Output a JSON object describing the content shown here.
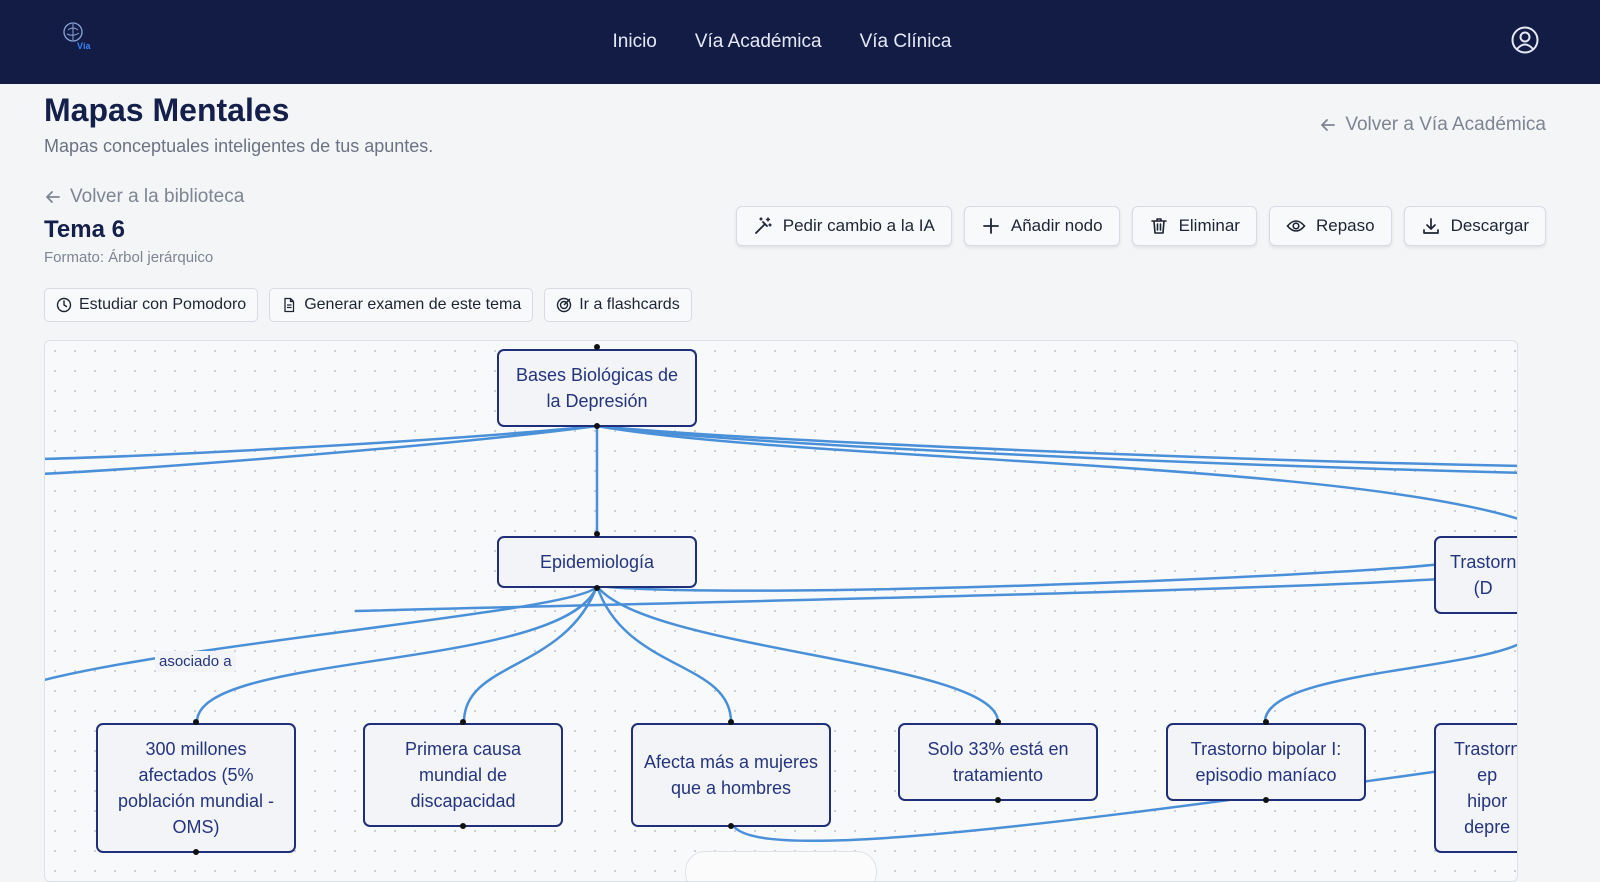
{
  "brand": {
    "logo_text": "Vía"
  },
  "nav": {
    "items": [
      "Inicio",
      "Vía Académica",
      "Vía Clínica"
    ]
  },
  "header": {
    "title": "Mapas Mentales",
    "subtitle": "Mapas conceptuales inteligentes de tus apuntes.",
    "back_academic": "Volver a Vía Académica"
  },
  "topic": {
    "back_library": "Volver a la biblioteca",
    "title": "Tema 6",
    "format": "Formato: Árbol jerárquico"
  },
  "toolbar": {
    "ai_change": "Pedir cambio a la IA",
    "add_node": "Añadir nodo",
    "delete": "Eliminar",
    "review": "Repaso",
    "download": "Descargar"
  },
  "actions": {
    "pomodoro": "Estudiar con Pomodoro",
    "exam": "Generar examen de este tema",
    "flashcards": "Ir a flashcards"
  },
  "mindmap": {
    "root": "Bases Biológicas de la Depresión",
    "epidemiology": "Epidemiología",
    "right_top_partial": "Trastorn\n(D",
    "leaves": [
      "300 millones afectados (5% población mundial - OMS)",
      "Primera causa mundial de discapacidad",
      "Afecta más a mujeres que a hombres",
      "Solo 33% está en tratamiento",
      "Trastorno bipolar I: episodio maníaco"
    ],
    "right_bottom_partial": "Trastorn\nep\nhipor\ndepre",
    "edge_label": "asociado a"
  },
  "colors": {
    "nav_bg": "#121c45",
    "edge": "#4a90d9",
    "node_border": "#1f2f7a"
  }
}
